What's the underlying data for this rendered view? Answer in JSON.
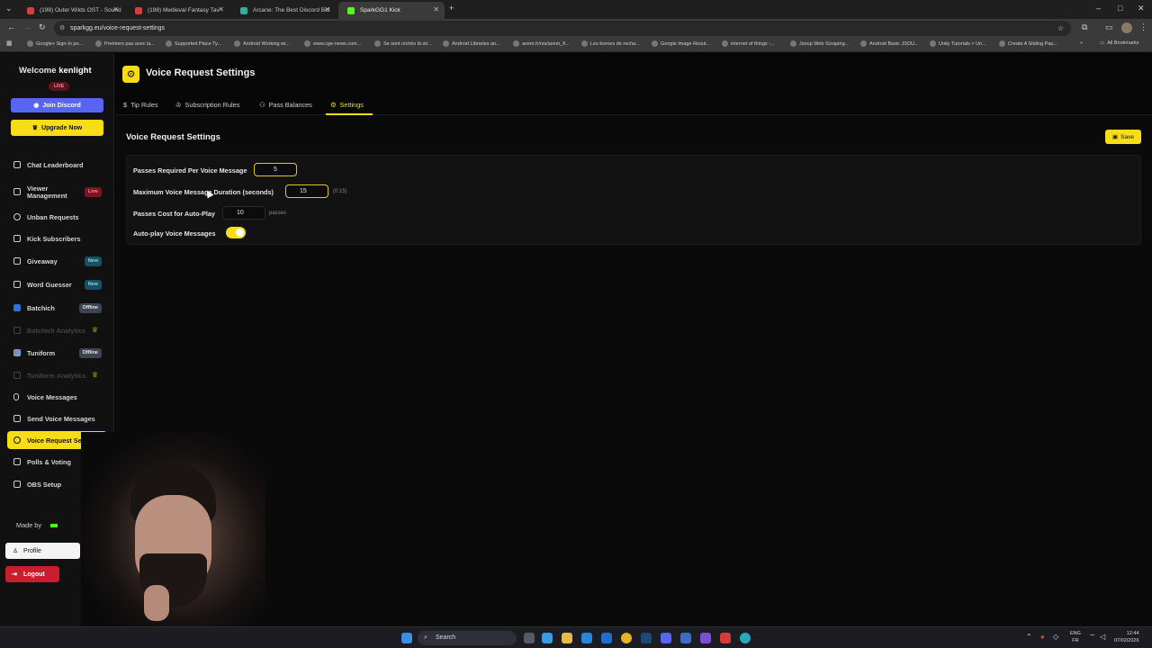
{
  "browser": {
    "tabs": [
      {
        "title": "(198) Outer Wilds OST - Sound",
        "color": "#d93d3d"
      },
      {
        "title": "(198) Medieval Fantasy Tav",
        "color": "#d93d3d"
      },
      {
        "title": "Arcane: The Best Discord Bot",
        "color": "#2ab0a0"
      },
      {
        "title": "SparkGG1 Kick",
        "color": "#53fc18"
      }
    ],
    "url": "sparkgg.eu/voice-request-settings",
    "bookmarks": [
      "Google+ Sign-In po...",
      "Premiers pas avec la...",
      "Supported Place Ty...",
      "Android Working wi...",
      "www.cge-news.com...",
      "Se sont nichés là str...",
      "Android Libraries an...",
      "avem.fr/rss/avem_fl...",
      "Les bornes de recha...",
      "Google Image Resul...",
      "internet of things -...",
      "Jsoup Web Scraping...",
      "Android Basic JSOU...",
      "Unity Tutorials > Un...",
      "Create A Sliding Pau...",
      "All Bookmarks"
    ]
  },
  "sidebar": {
    "welcome": "Welcome",
    "username": "kenlight",
    "live_badge": "LIVE",
    "join_discord": "Join Discord",
    "upgrade": "Upgrade Now",
    "items": [
      {
        "label": "Chat Leaderboard"
      },
      {
        "label": "Viewer Management",
        "badge": "Live"
      },
      {
        "label": "Unban Requests"
      },
      {
        "label": "Kick Subscribers"
      },
      {
        "label": "Giveaway",
        "badge": "New"
      },
      {
        "label": "Word Guesser",
        "badge": "New"
      },
      {
        "label": "Batchich",
        "badge": "Offline"
      },
      {
        "label": "Batchich Analytics"
      },
      {
        "label": "Tuniform",
        "badge": "Offline"
      },
      {
        "label": "Tuniform Analytics"
      },
      {
        "label": "Voice Messages"
      },
      {
        "label": "Send Voice Messages"
      },
      {
        "label": "Voice Request Settings"
      },
      {
        "label": "Polls & Voting"
      },
      {
        "label": "OBS Setup"
      }
    ],
    "made_by": "Made by",
    "profile": "Profile",
    "logout": "Logout"
  },
  "header": {
    "title": "Voice Request Settings",
    "tabs": [
      "Tip Rules",
      "Subscription Rules",
      "Pass Balances",
      "Settings"
    ]
  },
  "content": {
    "section_title": "Voice Request Settings",
    "save": "Save",
    "fields": {
      "passes_required_label": "Passes Required Per Voice Message",
      "passes_required_value": "5",
      "max_duration_label": "Maximum Voice Message Duration (seconds)",
      "max_duration_value": "15",
      "max_duration_hint": "(0:15)",
      "autoplay_cost_label": "Passes Cost for Auto-Play",
      "autoplay_cost_value": "10",
      "autoplay_cost_unit": "passes",
      "autoplay_label": "Auto-play Voice Messages",
      "autoplay_enabled": "on"
    }
  },
  "taskbar": {
    "search_placeholder": "Search",
    "lang_top": "ENG",
    "lang_bottom": "FR",
    "time": "12:44",
    "date": "07/02/2026"
  },
  "colors": {
    "accent": "#f6dd16",
    "discord": "#5865f2",
    "logout": "#c81e2d"
  }
}
